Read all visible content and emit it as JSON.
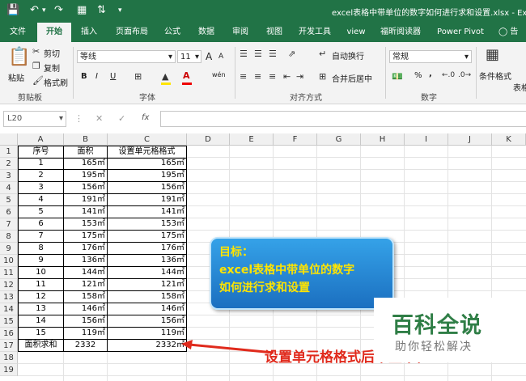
{
  "window": {
    "title": "excel表格中带单位的数字如何进行求和设置.xlsx - Exc"
  },
  "ribbon_tabs": [
    "文件",
    "开始",
    "插入",
    "页面布局",
    "公式",
    "数据",
    "审阅",
    "视图",
    "开发工具",
    "view",
    "福昕阅读器",
    "Power Pivot",
    "告诉"
  ],
  "clipboard": {
    "paste": "粘贴",
    "cut": "剪切",
    "copy": "复制",
    "format_painter": "格式刷",
    "group": "剪贴板"
  },
  "font": {
    "name": "等线",
    "size": "11",
    "group": "字体",
    "bold": "B",
    "italic": "I",
    "underline": "U",
    "grow": "A",
    "shrink": "A",
    "wen": "wén"
  },
  "alignment": {
    "wrap": "自动换行",
    "merge": "合并后居中",
    "group": "对齐方式"
  },
  "number": {
    "format": "常规",
    "group": "数字",
    "percent": "%",
    "comma": ","
  },
  "styles": {
    "conditional": "条件格式",
    "table": "表格格"
  },
  "formula_bar": {
    "name_box": "L20",
    "fx": "fx"
  },
  "columns": [
    "A",
    "B",
    "C",
    "D",
    "E",
    "F",
    "G",
    "H",
    "I",
    "J",
    "K"
  ],
  "rows": [
    "1",
    "2",
    "3",
    "4",
    "5",
    "6",
    "7",
    "8",
    "9",
    "10",
    "11",
    "12",
    "13",
    "14",
    "15",
    "16",
    "17",
    "18",
    "19"
  ],
  "table": {
    "headers": [
      "序号",
      "面积",
      "设置单元格格式"
    ],
    "rows": [
      [
        "1",
        "165㎡",
        "165㎡"
      ],
      [
        "2",
        "195㎡",
        "195㎡"
      ],
      [
        "3",
        "156㎡",
        "156㎡"
      ],
      [
        "4",
        "191㎡",
        "191㎡"
      ],
      [
        "5",
        "141㎡",
        "141㎡"
      ],
      [
        "6",
        "153㎡",
        "153㎡"
      ],
      [
        "7",
        "175㎡",
        "175㎡"
      ],
      [
        "8",
        "176㎡",
        "176㎡"
      ],
      [
        "9",
        "136㎡",
        "136㎡"
      ],
      [
        "10",
        "144㎡",
        "144㎡"
      ],
      [
        "11",
        "121㎡",
        "121㎡"
      ],
      [
        "12",
        "158㎡",
        "158㎡"
      ],
      [
        "13",
        "146㎡",
        "146㎡"
      ],
      [
        "14",
        "156㎡",
        "156㎡"
      ],
      [
        "15",
        "119㎡",
        "119㎡"
      ]
    ],
    "total": [
      "面积求和",
      "2332",
      "2332㎡"
    ]
  },
  "callout": {
    "line1": "目标：",
    "line2": "excel表格中带单位的数字",
    "line3": "如何进行求和设置"
  },
  "annotation": "设置单元格格式后带上单位",
  "watermark": {
    "logo": "百科全说",
    "sub": "助你轻松解决"
  },
  "colors": {
    "excel_green": "#217346",
    "callout_blue": "#1b6fc0",
    "callout_text": "#ffe400",
    "annotation_red": "#e02a1c"
  }
}
